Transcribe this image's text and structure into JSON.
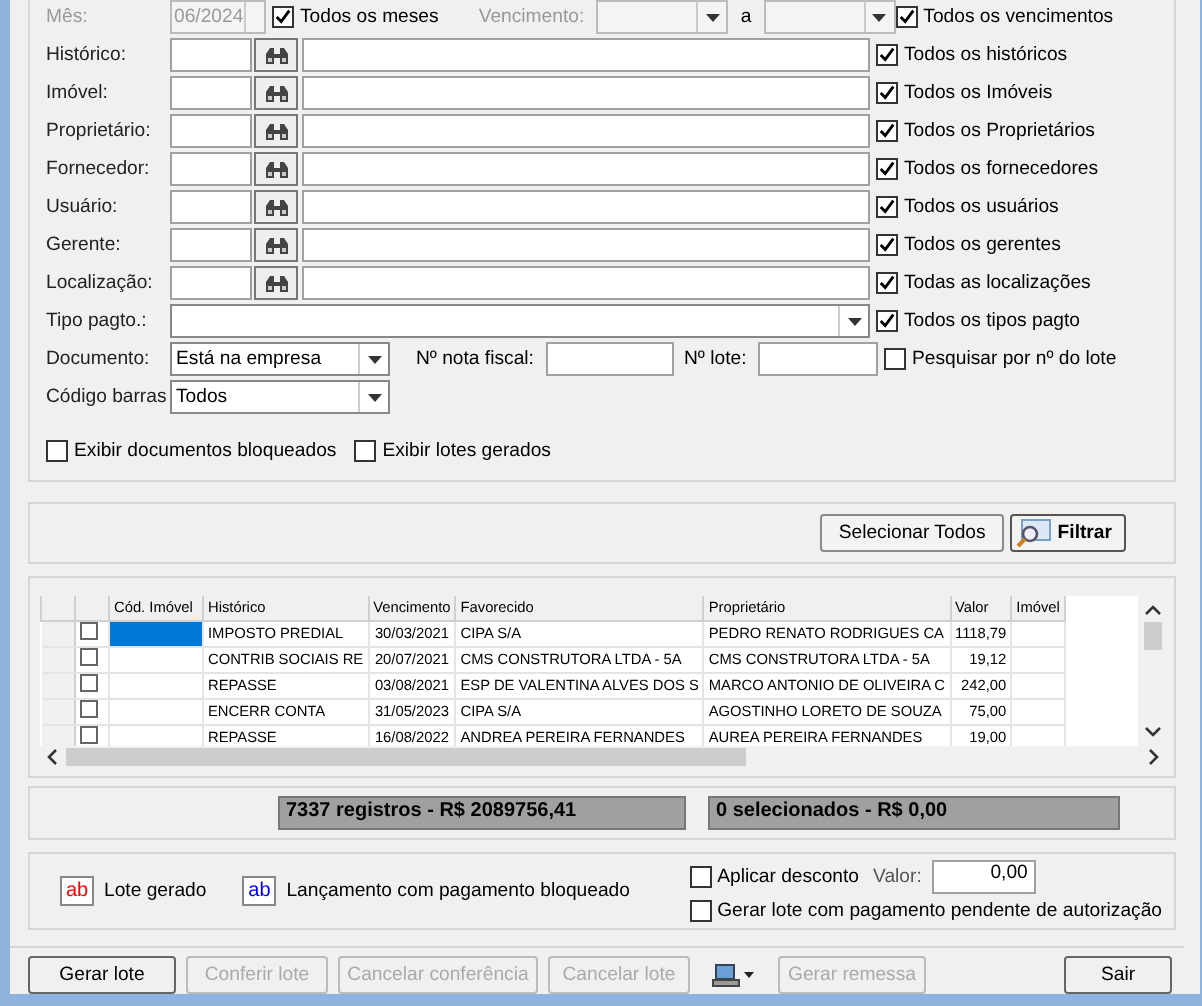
{
  "filters": {
    "month": {
      "label": "Mês:",
      "value": "06/2024",
      "disabled": true,
      "all_label": "Todos os meses",
      "checked": true
    },
    "due": {
      "label": "Vencimento:",
      "separator": "a",
      "disabled": true,
      "all_label": "Todos os vencimentos",
      "checked": true
    },
    "lookups": [
      {
        "label": "Histórico:",
        "all_label": "Todos os históricos",
        "checked": true
      },
      {
        "label": "Imóvel:",
        "all_label": "Todos os Imóveis",
        "checked": true
      },
      {
        "label": "Proprietário:",
        "all_label": "Todos os Proprietários",
        "checked": true
      },
      {
        "label": "Fornecedor:",
        "all_label": "Todos os fornecedores",
        "checked": true
      },
      {
        "label": "Usuário:",
        "all_label": "Todos os usuários",
        "checked": true
      },
      {
        "label": "Gerente:",
        "all_label": "Todos os gerentes",
        "checked": true
      },
      {
        "label": "Localização:",
        "all_label": "Todas as localizações",
        "checked": true
      }
    ],
    "payment_type": {
      "label": "Tipo pagto.:",
      "all_label": "Todos os tipos pagto",
      "checked": true
    },
    "document": {
      "label": "Documento:",
      "value": "Está na empresa"
    },
    "invoice": {
      "label": "Nº nota fiscal:"
    },
    "batch": {
      "label": "Nº lote:"
    },
    "search_by_batch": {
      "label": "Pesquisar por nº do lote",
      "checked": false
    },
    "barcode": {
      "label": "Código barras",
      "value": "Todos"
    },
    "options": [
      {
        "label": "Exibir documentos bloqueados",
        "checked": false
      },
      {
        "label": "Exibir lotes gerados",
        "checked": false
      }
    ]
  },
  "actions": [
    {
      "label": "Selecionar Todos",
      "kind": "plain"
    },
    {
      "label": "Filtrar",
      "kind": "filter"
    }
  ],
  "table": {
    "columns": [
      "Cód. Imóvel",
      "Histórico",
      "Vencimento",
      "Favorecido",
      "Proprietário",
      "Valor",
      "Imóvel"
    ],
    "rows": [
      {
        "checked": false,
        "selected": true,
        "cells": [
          "",
          "IMPOSTO PREDIAL",
          "30/03/2021",
          "CIPA S/A",
          "PEDRO RENATO RODRIGUES CA",
          "1118,79",
          ""
        ]
      },
      {
        "checked": false,
        "selected": false,
        "cells": [
          "",
          "CONTRIB SOCIAIS RE",
          "20/07/2021",
          "CMS CONSTRUTORA LTDA - 5A",
          "CMS CONSTRUTORA LTDA - 5A",
          "19,12",
          ""
        ]
      },
      {
        "checked": false,
        "selected": false,
        "cells": [
          "",
          "REPASSE",
          "03/08/2021",
          "ESP DE VALENTINA ALVES DOS S",
          "MARCO ANTONIO DE OLIVEIRA C",
          "242,00",
          ""
        ]
      },
      {
        "checked": false,
        "selected": false,
        "cells": [
          "",
          "ENCERR CONTA",
          "31/05/2023",
          "CIPA S/A",
          "AGOSTINHO LORETO DE SOUZA",
          "75,00",
          ""
        ]
      },
      {
        "checked": false,
        "selected": false,
        "cells": [
          "",
          "REPASSE",
          "16/08/2022",
          "ANDREA PEREIRA FERNANDES",
          "AUREA PEREIRA FERNANDES",
          "19,00",
          ""
        ]
      }
    ]
  },
  "totals": [
    "7337 registros - R$ 2089756,41",
    "0 selecionados - R$ 0,00"
  ],
  "legend": [
    {
      "sample": "ab",
      "label": "Lote gerado",
      "color": "#ff0000"
    },
    {
      "sample": "ab",
      "label": "Lançamento com pagamento bloqueado",
      "color": "#0000ff"
    }
  ],
  "discount": {
    "label": "Aplicar desconto",
    "checked": false,
    "value_label": "Valor:",
    "value": "0,00"
  },
  "pending": {
    "label": "Gerar lote com pagamento pendente de autorização",
    "checked": false
  },
  "buttons": [
    {
      "kind": "text",
      "label": "Gerar lote",
      "disabled": false
    },
    {
      "kind": "text",
      "label": "Conferir lote",
      "disabled": true
    },
    {
      "kind": "text",
      "label": "Cancelar conferência",
      "disabled": true
    },
    {
      "kind": "text",
      "label": "Cancelar lote",
      "disabled": true
    },
    {
      "kind": "menu"
    },
    {
      "kind": "text",
      "label": "Gerar remessa",
      "disabled": true
    },
    {
      "kind": "text",
      "label": "Sair",
      "disabled": false
    }
  ]
}
